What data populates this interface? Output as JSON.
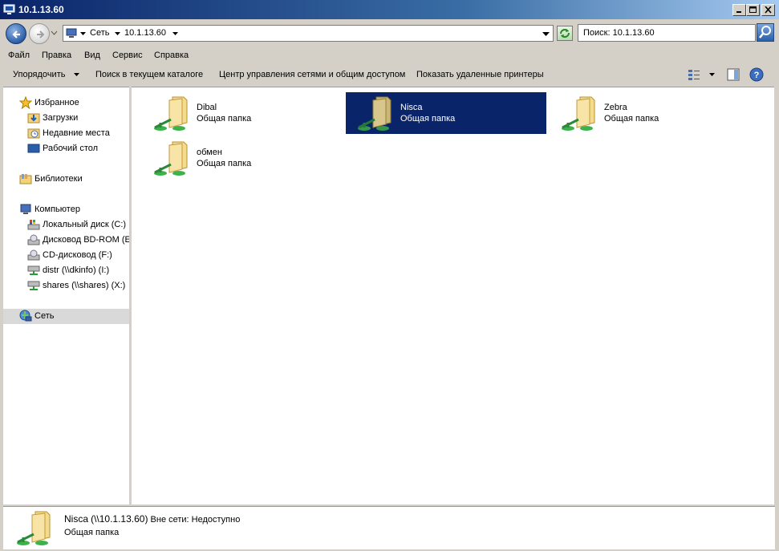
{
  "window": {
    "title": "10.1.13.60"
  },
  "address": {
    "segments": [
      "Сеть",
      "10.1.13.60"
    ],
    "search_placeholder": "Поиск: 10.1.13.60"
  },
  "menu": [
    "Файл",
    "Правка",
    "Вид",
    "Сервис",
    "Справка"
  ],
  "commands": {
    "organize": "Упорядочить",
    "search_current": "Поиск в текущем каталоге",
    "network_center": "Центр управления сетями и общим доступом",
    "show_printers": "Показать удаленные принтеры"
  },
  "sidebar": {
    "favorites": {
      "label": "Избранное",
      "icon": "star-icon"
    },
    "favorites_items": [
      {
        "label": "Загрузки",
        "icon": "downloads-folder-icon"
      },
      {
        "label": "Недавние места",
        "icon": "recent-places-icon"
      },
      {
        "label": "Рабочий стол",
        "icon": "desktop-icon"
      }
    ],
    "libraries": {
      "label": "Библиотеки",
      "icon": "libraries-icon"
    },
    "computer": {
      "label": "Компьютер",
      "icon": "computer-icon"
    },
    "computer_items": [
      {
        "label": "Локальный диск (C:)",
        "icon": "local-disk-icon"
      },
      {
        "label": "Дисковод BD-ROM (E",
        "icon": "bd-rom-drive-icon"
      },
      {
        "label": "CD-дисковод (F:)",
        "icon": "cd-drive-icon"
      },
      {
        "label": "distr (\\\\dkinfo) (I:)",
        "icon": "network-drive-icon"
      },
      {
        "label": "shares (\\\\shares) (X:)",
        "icon": "network-drive-icon"
      }
    ],
    "network": {
      "label": "Сеть",
      "icon": "network-icon",
      "selected": true
    }
  },
  "folders": [
    {
      "name": "Dibal",
      "type": "Общая папка",
      "selected": false
    },
    {
      "name": "Nisca",
      "type": "Общая папка",
      "selected": true
    },
    {
      "name": "Zebra",
      "type": "Общая папка",
      "selected": false
    },
    {
      "name": "обмен",
      "type": "Общая папка",
      "selected": false
    }
  ],
  "details": {
    "name": "Nisca",
    "path": "(\\\\10.1.13.60)",
    "status": "Вне сети: Недоступно",
    "type": "Общая папка"
  },
  "colors": {
    "selection": "#0a246a",
    "chrome": "#d4d0c8",
    "folder": "#f2d37a"
  }
}
